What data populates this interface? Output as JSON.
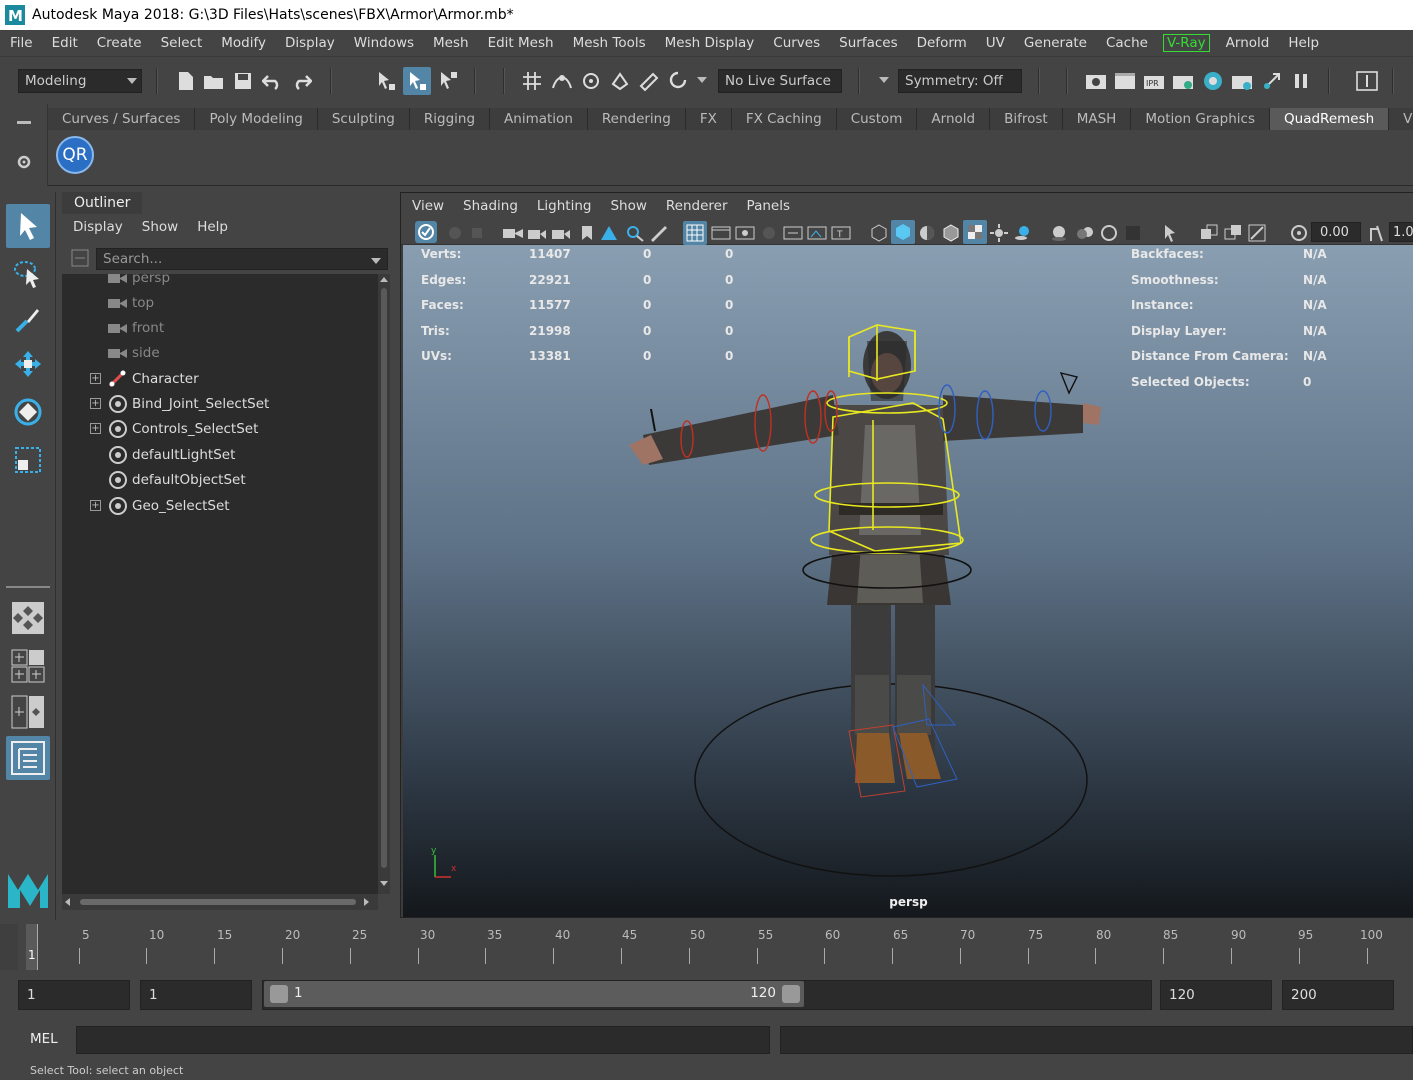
{
  "window": {
    "title": "Autodesk Maya 2018: G:\\3D Files\\Hats\\scenes\\FBX\\Armor\\Armor.mb*"
  },
  "menu": [
    "File",
    "Edit",
    "Create",
    "Select",
    "Modify",
    "Display",
    "Windows",
    "Mesh",
    "Edit Mesh",
    "Mesh Tools",
    "Mesh Display",
    "Curves",
    "Surfaces",
    "Deform",
    "UV",
    "Generate",
    "Cache",
    "V-Ray",
    "Arnold",
    "Help"
  ],
  "status": {
    "menuset": "Modeling",
    "live_surface": "No Live Surface",
    "symmetry": "Symmetry: Off"
  },
  "shelf": {
    "tabs": [
      "Curves / Surfaces",
      "Poly Modeling",
      "Sculpting",
      "Rigging",
      "Animation",
      "Rendering",
      "FX",
      "FX Caching",
      "Custom",
      "Arnold",
      "Bifrost",
      "MASH",
      "Motion Graphics",
      "QuadRemesh",
      "V"
    ],
    "active_tab": "QuadRemesh",
    "button_label": "QR"
  },
  "outliner": {
    "title": "Outliner",
    "menu": [
      "Display",
      "Show",
      "Help"
    ],
    "search_placeholder": "Search...",
    "items": [
      {
        "label": "persp"
      },
      {
        "label": "top"
      },
      {
        "label": "front"
      },
      {
        "label": "side"
      },
      {
        "label": "Character"
      },
      {
        "label": "Bind_Joint_SelectSet"
      },
      {
        "label": "Controls_SelectSet"
      },
      {
        "label": "defaultLightSet"
      },
      {
        "label": "defaultObjectSet"
      },
      {
        "label": "Geo_SelectSet"
      }
    ]
  },
  "viewport": {
    "menu": [
      "View",
      "Shading",
      "Lighting",
      "Show",
      "Renderer",
      "Panels"
    ],
    "exposure": "0.00",
    "gamma": "1.0",
    "camera": "persp",
    "stats": [
      {
        "label": "Verts:",
        "v1": "11407",
        "v2": "0",
        "v3": "0"
      },
      {
        "label": "Edges:",
        "v1": "22921",
        "v2": "0",
        "v3": "0"
      },
      {
        "label": "Faces:",
        "v1": "11577",
        "v2": "0",
        "v3": "0"
      },
      {
        "label": "Tris:",
        "v1": "21998",
        "v2": "0",
        "v3": "0"
      },
      {
        "label": "UVs:",
        "v1": "13381",
        "v2": "0",
        "v3": "0"
      }
    ],
    "info": [
      {
        "label": "Backfaces:",
        "value": "N/A"
      },
      {
        "label": "Smoothness:",
        "value": "N/A"
      },
      {
        "label": "Instance:",
        "value": "N/A"
      },
      {
        "label": "Display Layer:",
        "value": "N/A"
      },
      {
        "label": "Distance From Camera:",
        "value": "N/A"
      },
      {
        "label": "Selected Objects:",
        "value": "0"
      }
    ]
  },
  "timeline": {
    "ticks": [
      "5",
      "10",
      "15",
      "20",
      "25",
      "30",
      "35",
      "40",
      "45",
      "50",
      "55",
      "60",
      "65",
      "70",
      "75",
      "80",
      "85",
      "90",
      "95",
      "100"
    ],
    "current": "1"
  },
  "range": {
    "start": "1",
    "anim_start": "1",
    "bar_start": "1",
    "bar_end": "120",
    "anim_end": "120",
    "end": "200"
  },
  "cmd": {
    "lang": "MEL"
  },
  "help": "Select Tool: select an object",
  "colors": {
    "accent": "#5285a6",
    "vray": "#33dd33",
    "selection": "#e8e820"
  }
}
